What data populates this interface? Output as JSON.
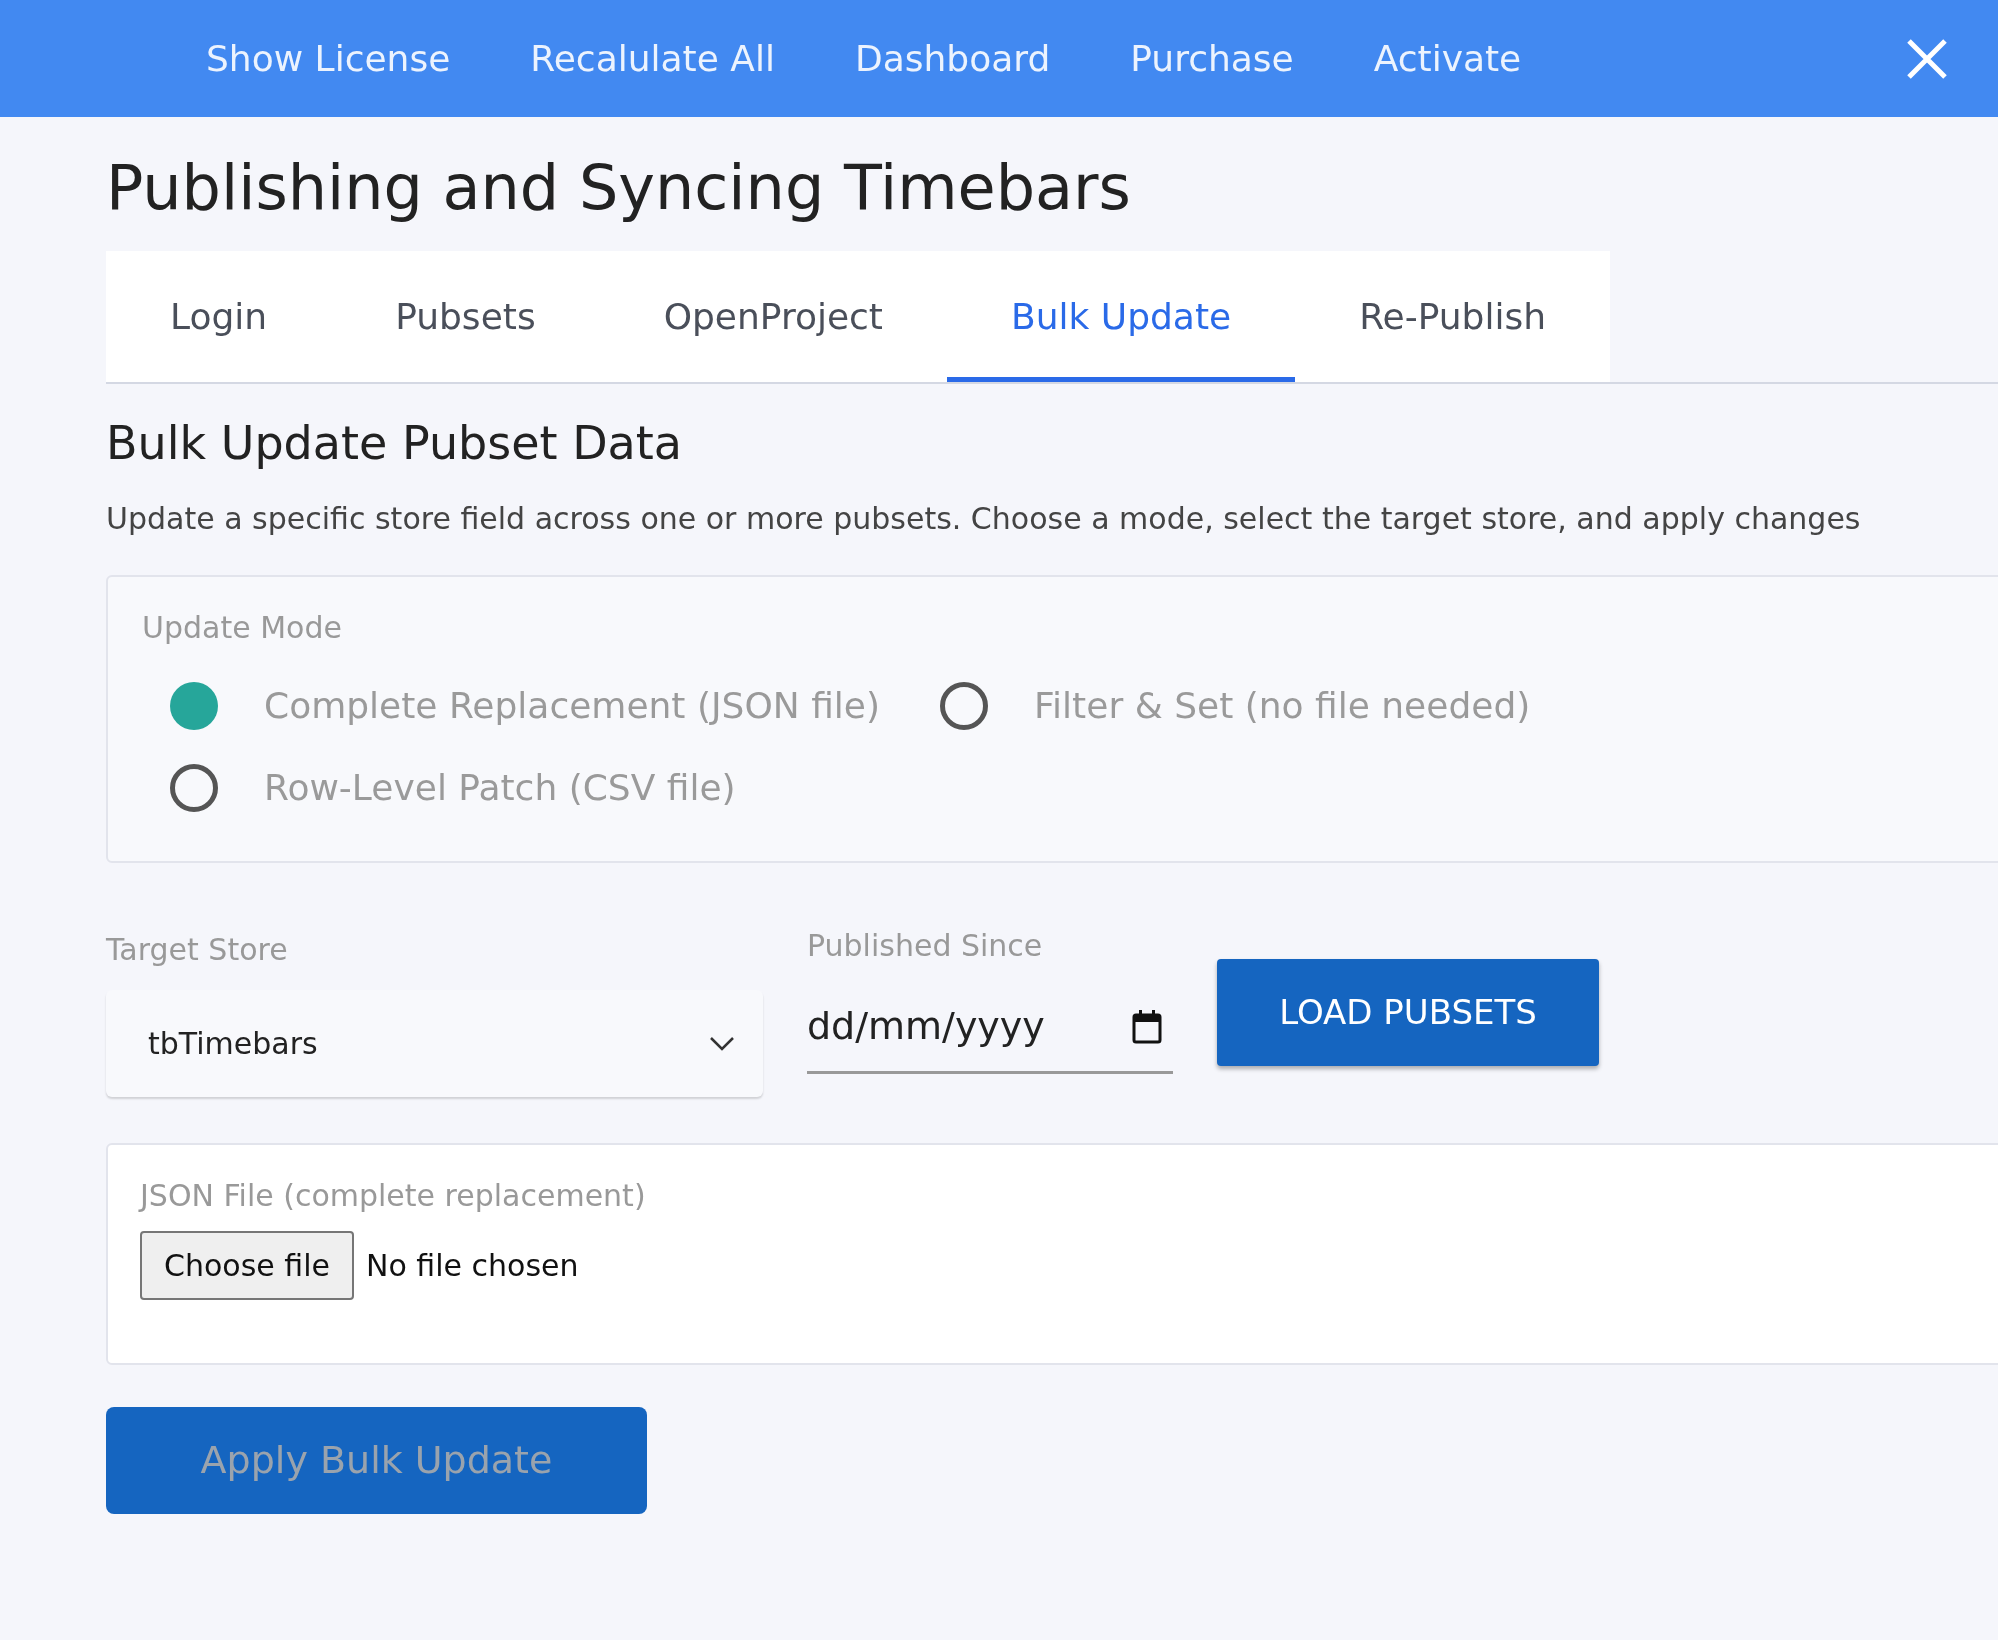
{
  "top_nav": {
    "items": [
      "Show License",
      "Recalulate All",
      "Dashboard",
      "Purchase",
      "Activate"
    ]
  },
  "page_title": "Publishing and Syncing Timebars",
  "tabs": [
    {
      "label": "Login",
      "selected": false
    },
    {
      "label": "Pubsets",
      "selected": false
    },
    {
      "label": "OpenProject",
      "selected": false
    },
    {
      "label": "Bulk Update",
      "selected": true
    },
    {
      "label": "Re-Publish",
      "selected": false
    }
  ],
  "section": {
    "title": "Bulk Update Pubset Data",
    "description": "Update a specific store field across one or more pubsets. Choose a mode, select the target store, and apply changes"
  },
  "update_mode": {
    "legend": "Update Mode",
    "options": [
      {
        "label": "Complete Replacement (JSON file)",
        "selected": true
      },
      {
        "label": "Filter & Set (no file needed)",
        "selected": false
      },
      {
        "label": "Row-Level Patch (CSV file)",
        "selected": false
      }
    ]
  },
  "target_store": {
    "label": "Target Store",
    "value": "tbTimebars"
  },
  "published_since": {
    "label": "Published Since",
    "placeholder": "dd/mm/yyyy"
  },
  "load_button": "LOAD PUBSETS",
  "file_upload": {
    "label": "JSON File (complete replacement)",
    "button": "Choose file",
    "status": "No file chosen"
  },
  "apply_button": {
    "label": "Apply Bulk Update",
    "disabled": true
  }
}
